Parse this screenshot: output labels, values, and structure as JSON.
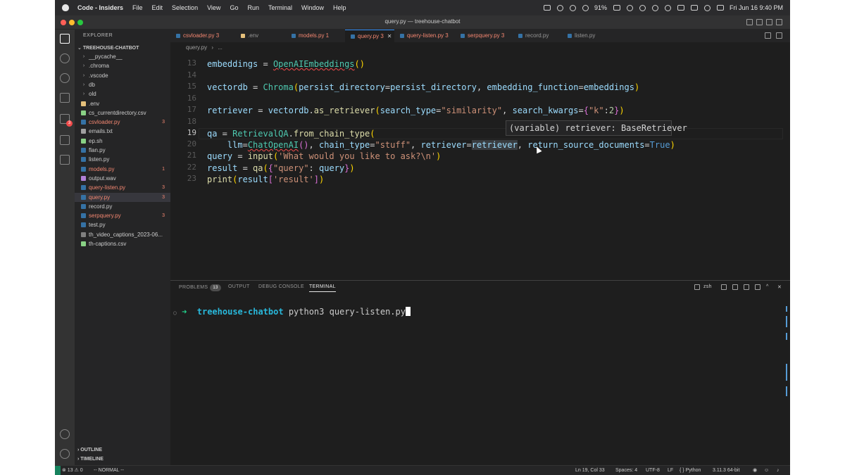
{
  "menubar": {
    "items": [
      "Code - Insiders",
      "File",
      "Edit",
      "Selection",
      "View",
      "Go",
      "Run",
      "Terminal",
      "Window",
      "Help"
    ],
    "battery": "91%",
    "clock": "Fri Jun 16  9:40 PM"
  },
  "window": {
    "title": "query.py — treehouse-chatbot"
  },
  "sidebar": {
    "title": "EXPLORER",
    "project": "TREEHOUSE-CHATBOT",
    "files": [
      {
        "name": "__pycache__",
        "type": "folder",
        "color": "#cccccc",
        "badge": ""
      },
      {
        "name": ".chroma",
        "type": "folder",
        "color": "#cccccc",
        "badge": ""
      },
      {
        "name": ".vscode",
        "type": "folder",
        "color": "#cccccc",
        "badge": ""
      },
      {
        "name": "db",
        "type": "folder",
        "color": "#cccccc",
        "badge": ""
      },
      {
        "name": "old",
        "type": "folder",
        "color": "#cccccc",
        "badge": ""
      },
      {
        "name": ".env",
        "type": "file",
        "color": "#cccccc",
        "badge": ""
      },
      {
        "name": "cs_currentdirectory.csv",
        "type": "file",
        "color": "#cccccc",
        "badge": ""
      },
      {
        "name": "csvloader.py",
        "type": "file",
        "color": "#f48771",
        "badge": "3"
      },
      {
        "name": "emails.txt",
        "type": "file",
        "color": "#cccccc",
        "badge": ""
      },
      {
        "name": "ep.sh",
        "type": "file",
        "color": "#cccccc",
        "badge": ""
      },
      {
        "name": "flan.py",
        "type": "file",
        "color": "#cccccc",
        "badge": ""
      },
      {
        "name": "listen.py",
        "type": "file",
        "color": "#cccccc",
        "badge": ""
      },
      {
        "name": "models.py",
        "type": "file",
        "color": "#f48771",
        "badge": "1"
      },
      {
        "name": "output.wav",
        "type": "file",
        "color": "#cccccc",
        "badge": ""
      },
      {
        "name": "query-listen.py",
        "type": "file",
        "color": "#f48771",
        "badge": "3"
      },
      {
        "name": "query.py",
        "type": "file",
        "color": "#f48771",
        "badge": "3"
      },
      {
        "name": "record.py",
        "type": "file",
        "color": "#cccccc",
        "badge": ""
      },
      {
        "name": "serpquery.py",
        "type": "file",
        "color": "#f48771",
        "badge": "3"
      },
      {
        "name": "test.py",
        "type": "file",
        "color": "#cccccc",
        "badge": ""
      },
      {
        "name": "th_video_captions_2023-06...",
        "type": "file",
        "color": "#cccccc",
        "badge": ""
      },
      {
        "name": "th-captions.csv",
        "type": "file",
        "color": "#cccccc",
        "badge": ""
      }
    ],
    "outline": "OUTLINE",
    "timeline": "TIMELINE"
  },
  "tabs": [
    {
      "name": "csvloader.py",
      "badge": "3",
      "error": true
    },
    {
      "name": ".env",
      "badge": "",
      "error": false
    },
    {
      "name": "models.py",
      "badge": "1",
      "error": true
    },
    {
      "name": "query.py",
      "badge": "3",
      "error": true,
      "active": true
    },
    {
      "name": "query-listen.py",
      "badge": "3",
      "error": true
    },
    {
      "name": "serpquery.py",
      "badge": "3",
      "error": true
    },
    {
      "name": "record.py",
      "badge": "",
      "error": false
    },
    {
      "name": "listen.py",
      "badge": "",
      "error": false
    }
  ],
  "breadcrumb": {
    "file": "query.py",
    "rest": "..."
  },
  "editor": {
    "line_numbers": [
      "13",
      "14",
      "15",
      "16",
      "17",
      "18",
      "19",
      "20",
      "21",
      "22",
      "23"
    ],
    "current_line": "19",
    "hover": "(variable) retriever: BaseRetriever"
  },
  "panel": {
    "tabs": {
      "problems": "PROBLEMS",
      "problems_count": "13",
      "output": "OUTPUT",
      "debug": "DEBUG CONSOLE",
      "terminal": "TERMINAL"
    },
    "shell": "zsh",
    "terminal": {
      "dot": "○",
      "arrow": "➜",
      "dir": "treehouse-chatbot",
      "command": "python3 query-listen.py"
    }
  },
  "statusbar": {
    "problems": "⊗ 13 ⚠ 0",
    "mode": "-- NORMAL --",
    "position": "Ln 19, Col 33",
    "spaces": "Spaces: 4",
    "encoding": "UTF-8",
    "eol": "LF",
    "language": "Python",
    "interpreter": "3.11.3 64-bit"
  }
}
